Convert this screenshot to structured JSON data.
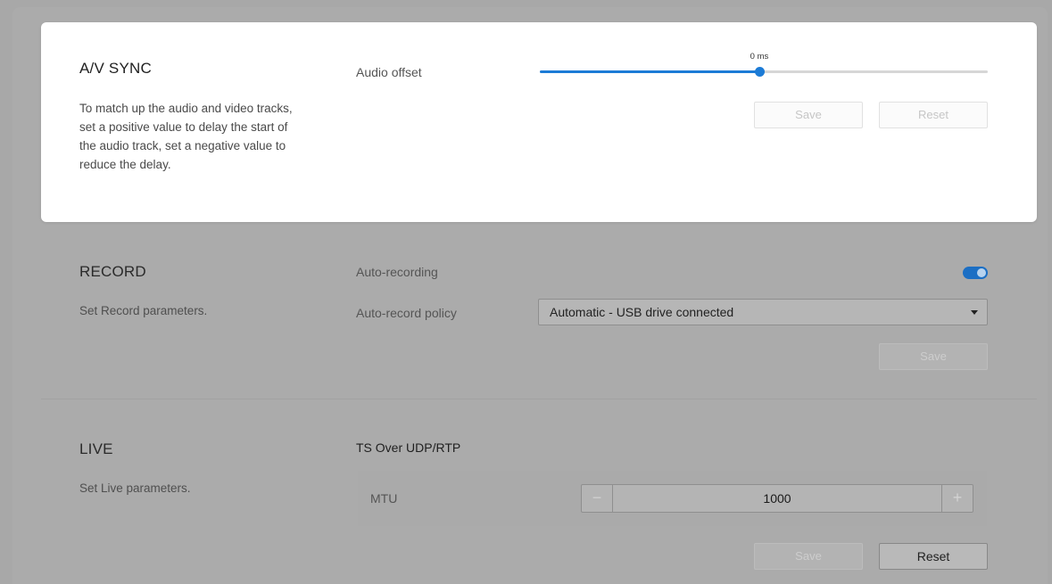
{
  "av_sync": {
    "title": "A/V SYNC",
    "description": "To match up the audio and video tracks, set a positive value to delay the start of the audio track, set a negative value to reduce the delay.",
    "audio_offset_label": "Audio offset",
    "audio_offset_value": "0 ms",
    "slider_fraction": 0.49,
    "save_label": "Save",
    "reset_label": "Reset"
  },
  "record": {
    "title": "RECORD",
    "description": "Set Record parameters.",
    "auto_recording_label": "Auto-recording",
    "auto_recording_on": true,
    "policy_label": "Auto-record policy",
    "policy_value": "Automatic - USB drive connected",
    "save_label": "Save"
  },
  "live": {
    "title": "LIVE",
    "description": "Set Live parameters.",
    "protocol_heading": "TS Over UDP/RTP",
    "mtu_label": "MTU",
    "mtu_value": "1000",
    "minus_symbol": "−",
    "plus_symbol": "+",
    "save_label": "Save",
    "reset_label": "Reset"
  },
  "colors": {
    "accent": "#1c7bd6",
    "overlay": "#a8a8a8",
    "card": "#ffffff"
  }
}
